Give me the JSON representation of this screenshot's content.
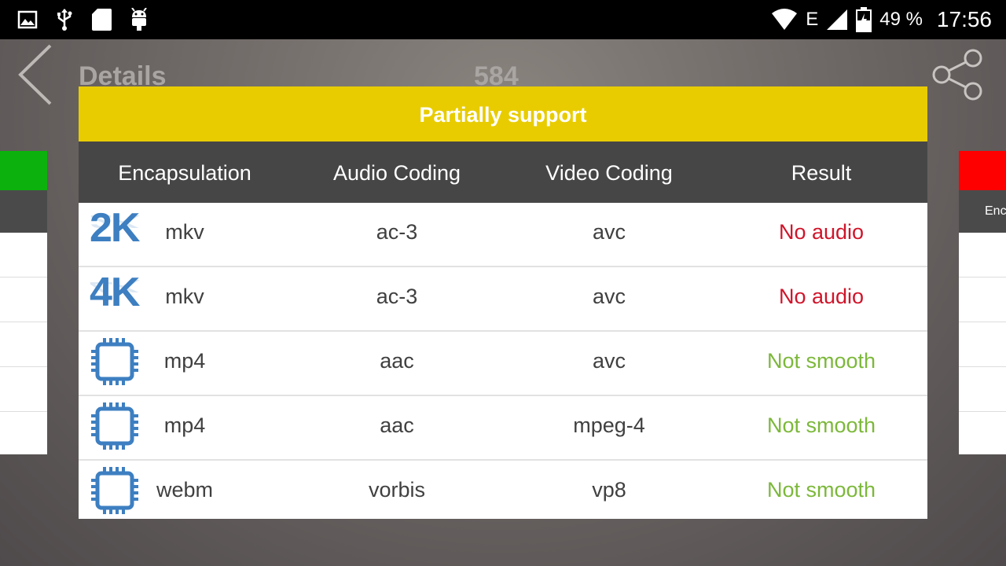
{
  "status_bar": {
    "left_icons": [
      "image-icon",
      "usb-icon",
      "sd-card-icon",
      "android-icon"
    ],
    "network": "E",
    "battery": "49 %",
    "time": "17:56"
  },
  "app_bar": {
    "title": "Details",
    "count": "584"
  },
  "right_card": {
    "header_fragment": "Enc"
  },
  "dialog": {
    "title": "Partially support",
    "title_color": "#e8cc00",
    "columns": [
      "Encapsulation",
      "Audio Coding",
      "Video Coding",
      "Result"
    ],
    "rows": [
      {
        "badge": "2K",
        "icon": "2k-badge-icon",
        "encapsulation": "mkv",
        "audio": "ac-3",
        "video": "avc",
        "result": "No audio",
        "result_color": "#d0142a"
      },
      {
        "badge": "4K",
        "icon": "4k-badge-icon",
        "encapsulation": "mkv",
        "audio": "ac-3",
        "video": "avc",
        "result": "No audio",
        "result_color": "#d0142a"
      },
      {
        "badge": "",
        "icon": "chip-icon",
        "encapsulation": "mp4",
        "audio": "aac",
        "video": "avc",
        "result": "Not smooth",
        "result_color": "#7cb83a"
      },
      {
        "badge": "",
        "icon": "chip-icon",
        "encapsulation": "mp4",
        "audio": "aac",
        "video": "mpeg-4",
        "result": "Not smooth",
        "result_color": "#7cb83a"
      },
      {
        "badge": "",
        "icon": "chip-icon",
        "encapsulation": "webm",
        "audio": "vorbis",
        "video": "vp8",
        "result": "Not smooth",
        "result_color": "#7cb83a"
      }
    ]
  }
}
